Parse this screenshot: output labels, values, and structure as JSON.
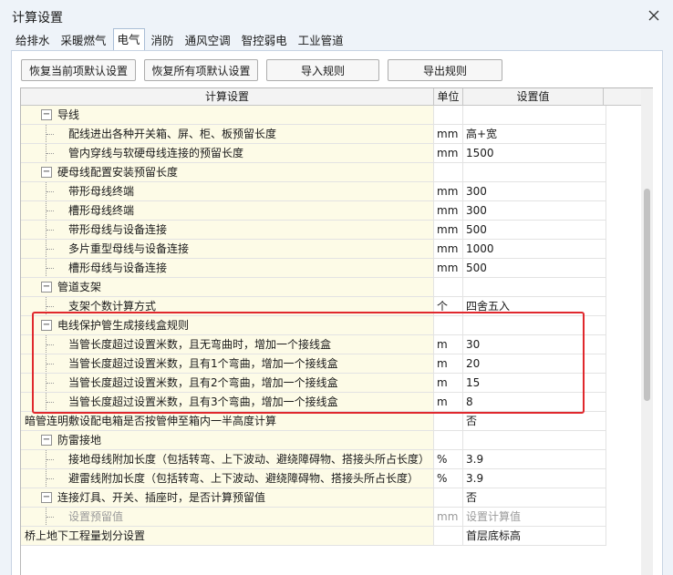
{
  "window": {
    "title": "计算设置"
  },
  "tabs": [
    {
      "label": "给排水",
      "active": false
    },
    {
      "label": "采暖燃气",
      "active": false
    },
    {
      "label": "电气",
      "active": true
    },
    {
      "label": "消防",
      "active": false
    },
    {
      "label": "通风空调",
      "active": false
    },
    {
      "label": "智控弱电",
      "active": false
    },
    {
      "label": "工业管道",
      "active": false
    }
  ],
  "toolbar": {
    "restore_current": "恢复当前项默认设置",
    "restore_all": "恢复所有项默认设置",
    "import_rules": "导入规则",
    "export_rules": "导出规则"
  },
  "grid": {
    "headers": {
      "setting": "计算设置",
      "unit": "单位",
      "value": "设置值"
    },
    "rows": [
      {
        "level": 0,
        "toggle": "−",
        "label": "导线",
        "unit": "",
        "value": ""
      },
      {
        "level": 1,
        "label": "配线进出各种开关箱、屏、柜、板预留长度",
        "unit": "mm",
        "value": "高+宽"
      },
      {
        "level": 1,
        "label": "管内穿线与软硬母线连接的预留长度",
        "unit": "mm",
        "value": "1500"
      },
      {
        "level": 0,
        "toggle": "−",
        "label": "硬母线配置安装预留长度",
        "unit": "",
        "value": ""
      },
      {
        "level": 1,
        "label": "带形母线终端",
        "unit": "mm",
        "value": "300"
      },
      {
        "level": 1,
        "label": "槽形母线终端",
        "unit": "mm",
        "value": "300"
      },
      {
        "level": 1,
        "label": "带形母线与设备连接",
        "unit": "mm",
        "value": "500"
      },
      {
        "level": 1,
        "label": "多片重型母线与设备连接",
        "unit": "mm",
        "value": "1000"
      },
      {
        "level": 1,
        "label": "槽形母线与设备连接",
        "unit": "mm",
        "value": "500"
      },
      {
        "level": 0,
        "toggle": "−",
        "label": "管道支架",
        "unit": "",
        "value": ""
      },
      {
        "level": 1,
        "label": "支架个数计算方式",
        "unit": "个",
        "value": "四舍五入"
      },
      {
        "level": 0,
        "toggle": "−",
        "label": "电线保护管生成接线盒规则",
        "unit": "",
        "value": ""
      },
      {
        "level": 1,
        "label": "当管长度超过设置米数，且无弯曲时，增加一个接线盒",
        "unit": "m",
        "value": "30"
      },
      {
        "level": 1,
        "label": "当管长度超过设置米数，且有1个弯曲，增加一个接线盒",
        "unit": "m",
        "value": "20"
      },
      {
        "level": 1,
        "label": "当管长度超过设置米数，且有2个弯曲，增加一个接线盒",
        "unit": "m",
        "value": "15"
      },
      {
        "level": 1,
        "label": "当管长度超过设置米数，且有3个弯曲，增加一个接线盒",
        "unit": "m",
        "value": "8"
      },
      {
        "level": -1,
        "label": "暗管连明敷设配电箱是否按管伸至箱内一半高度计算",
        "unit": "",
        "value": "否"
      },
      {
        "level": 0,
        "toggle": "−",
        "label": "防雷接地",
        "unit": "",
        "value": ""
      },
      {
        "level": 1,
        "label": "接地母线附加长度（包括转弯、上下波动、避绕障碍物、搭接头所占长度）",
        "unit": "%",
        "value": "3.9"
      },
      {
        "level": 1,
        "label": "避雷线附加长度（包括转弯、上下波动、避绕障碍物、搭接头所占长度）",
        "unit": "%",
        "value": "3.9"
      },
      {
        "level": 0,
        "toggle": "−",
        "label": "连接灯具、开关、插座时，是否计算预留值",
        "unit": "",
        "value": "否"
      },
      {
        "level": 1,
        "label": "设置预留值",
        "unit": "mm",
        "value": "设置计算值",
        "gray": true
      },
      {
        "level": -1,
        "label": "桥上地下工程量划分设置",
        "unit": "",
        "value": "首层底标高"
      }
    ]
  },
  "colors": {
    "highlight": "#e0282d",
    "label_bg": "#fdfbe7"
  }
}
